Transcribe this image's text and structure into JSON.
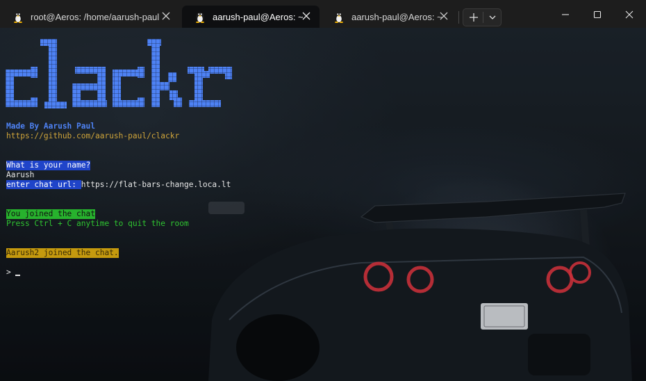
{
  "tabs": [
    {
      "title": "root@Aeros: /home/aarush-paul",
      "icon": "tux-linux-icon",
      "active": false
    },
    {
      "title": "aarush-paul@Aeros: ~",
      "icon": "tux-linux-icon",
      "active": true
    },
    {
      "title": "aarush-paul@Aeros: ~",
      "icon": "tux-linux-icon",
      "active": false
    }
  ],
  "toolbar": {
    "new_tab_icon": "plus-icon",
    "dropdown_icon": "chevron-down-icon"
  },
  "window_controls": [
    "minimize-icon",
    "maximize-icon",
    "close-icon"
  ],
  "terminal": {
    "logo_text": "clackr",
    "credit": "Made By Aarush Paul",
    "repo_url": "https://github.com/aarush-paul/clackr",
    "name_question": "What is your name?",
    "name_answer": "Aarush",
    "chat_url_label": "enter chat url: ",
    "chat_url_value": "https://flat-bars-change.loca.lt",
    "joined_message": "You joined the chat",
    "quit_hint": "Press Ctrl + C anytime to quit the room",
    "event_message": "Aarush2 joined the chat.",
    "prompt": "> "
  },
  "colors": {
    "logo": "#4e82f4",
    "credit": "#4e82f4",
    "repo": "#d0a53a",
    "question_bg": "#1f44c9",
    "joined_bg": "#27b22d",
    "quit_hint": "#2fc431",
    "event_bg": "#c59a0e",
    "tail_lights": "#c8303a"
  }
}
